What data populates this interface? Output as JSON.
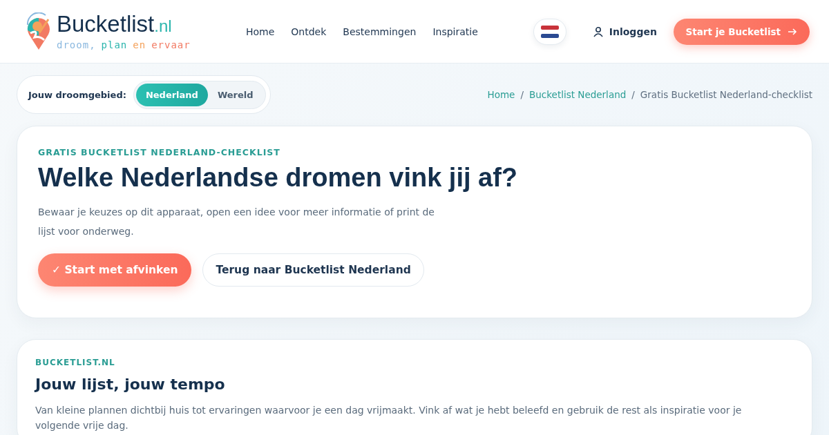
{
  "header": {
    "logo": {
      "name": "Bucketlist",
      "suffix": ".nl",
      "tagline": [
        {
          "text": "droom,",
          "color": "#8ab8df"
        },
        {
          "text": "plan",
          "color": "#2bb5ad"
        },
        {
          "text": "en",
          "color": "#f4a25b"
        },
        {
          "text": "ervaar",
          "color": "#f27a63"
        }
      ]
    },
    "nav": [
      {
        "label": "Home"
      },
      {
        "label": "Ontdek"
      },
      {
        "label": "Bestemmingen"
      },
      {
        "label": "Inspiratie"
      }
    ],
    "login": "Inloggen",
    "cta": "Start je Bucketlist"
  },
  "region": {
    "label": "Jouw droomgebied:",
    "options": [
      {
        "label": "Nederland",
        "selected": true
      },
      {
        "label": "Wereld",
        "selected": false
      }
    ]
  },
  "breadcrumb_separator": "/",
  "breadcrumb": [
    {
      "label": "Home",
      "link": true
    },
    {
      "label": "Bucketlist Nederland",
      "link": true
    },
    {
      "label": "Gratis Bucketlist Nederland-checklist",
      "link": false
    }
  ],
  "hero": {
    "eyebrow": "GRATIS BUCKETLIST NEDERLAND-CHECKLIST",
    "title": "Welke Nederlandse dromen vink jij af?",
    "text": "Bewaar je keuzes op dit apparaat, open een idee voor meer informatie of print de lijst voor onderweg.",
    "primary": "✓ Start met afvinken",
    "secondary": "Terug naar Bucketlist Nederland"
  },
  "intro": {
    "eyebrow": "BUCKETLIST.NL",
    "title": "Jouw lijst, jouw tempo",
    "text": "Van kleine plannen dichtbij huis tot ervaringen waarvoor je een dag vrijmaakt. Vink af wat je hebt beleefd en gebruik de rest als inspiratie voor je volgende vrije dag."
  }
}
